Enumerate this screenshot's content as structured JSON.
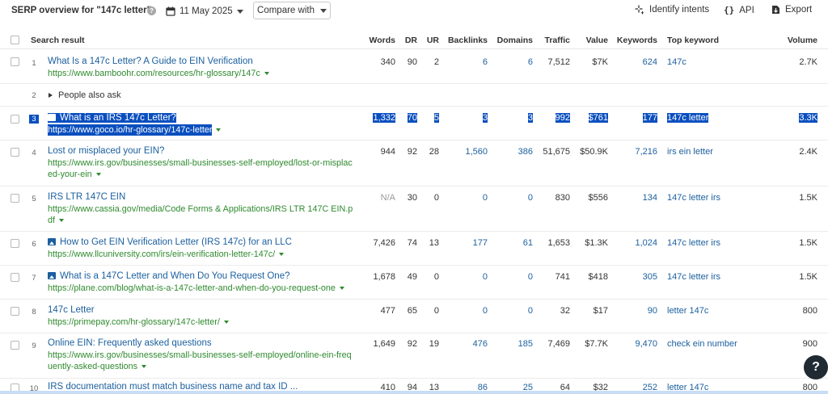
{
  "header": {
    "title": "SERP overview for \"147c letter\"",
    "date": "11 May 2025",
    "compare_label": "Compare with",
    "identify_label": "Identify intents",
    "api_label": "API",
    "export_label": "Export"
  },
  "columns": {
    "result": "Search result",
    "words": "Words",
    "dr": "DR",
    "ur": "UR",
    "backlinks": "Backlinks",
    "domains": "Domains",
    "traffic": "Traffic",
    "value": "Value",
    "keywords": "Keywords",
    "top_keyword": "Top keyword",
    "volume": "Volume"
  },
  "rows": [
    {
      "idx": "1",
      "title": "What Is a 147c Letter? A Guide to EIN Verification",
      "url_lines": [
        "https://www.bamboohr.com/resources/hr-glossary/147c"
      ],
      "words": "340",
      "dr": "90",
      "ur": "2",
      "backlinks": "6",
      "domains": "6",
      "traffic": "7,512",
      "value": "$7K",
      "keywords": "624",
      "top_keyword": "147c",
      "volume": "2.7K"
    },
    {
      "idx": "2",
      "paa": "People also ask"
    },
    {
      "idx": "3",
      "title": "What is an IRS 147c Letter?",
      "url_lines": [
        "https://www.goco.io/hr-glossary/147c-letter"
      ],
      "words": "1,332",
      "dr": "70",
      "ur": "5",
      "backlinks": "3",
      "domains": "3",
      "traffic": "992",
      "value": "$761",
      "keywords": "177",
      "top_keyword": "147c letter",
      "volume": "3.3K"
    },
    {
      "idx": "4",
      "title": "Lost or misplaced your EIN?",
      "url_lines": [
        "https://www.irs.gov/businesses/small-businesses-self-employed/lost-or-misplac",
        "ed-your-ein"
      ],
      "words": "944",
      "dr": "92",
      "ur": "28",
      "backlinks": "1,560",
      "domains": "386",
      "traffic": "51,675",
      "value": "$50.9K",
      "keywords": "7,216",
      "top_keyword": "irs ein letter",
      "volume": "2.4K"
    },
    {
      "idx": "5",
      "title": "IRS LTR 147C EIN",
      "url_lines": [
        "https://www.cassia.gov/media/Code Forms & Applications/IRS LTR 147C EIN.p",
        "df"
      ],
      "words": "N/A",
      "dr": "30",
      "ur": "0",
      "backlinks": "0",
      "domains": "0",
      "traffic": "830",
      "value": "$556",
      "keywords": "134",
      "top_keyword": "147c letter irs",
      "volume": "1.5K"
    },
    {
      "idx": "6",
      "title": "How to Get EIN Verification Letter (IRS 147c) for an LLC",
      "url_lines": [
        "https://www.llcuniversity.com/irs/ein-verification-letter-147c/"
      ],
      "words": "7,426",
      "dr": "74",
      "ur": "13",
      "backlinks": "177",
      "domains": "61",
      "traffic": "1,653",
      "value": "$1.3K",
      "keywords": "1,024",
      "top_keyword": "147c letter irs",
      "volume": "1.5K"
    },
    {
      "idx": "7",
      "title": "What is a 147C Letter and When Do You Request One?",
      "url_lines": [
        "https://plane.com/blog/what-is-a-147c-letter-and-when-do-you-request-one"
      ],
      "words": "1,678",
      "dr": "49",
      "ur": "0",
      "backlinks": "0",
      "domains": "0",
      "traffic": "741",
      "value": "$418",
      "keywords": "305",
      "top_keyword": "147c letter irs",
      "volume": "1.5K"
    },
    {
      "idx": "8",
      "title": "147c Letter",
      "url_lines": [
        "https://primepay.com/hr-glossary/147c-letter/"
      ],
      "words": "477",
      "dr": "65",
      "ur": "0",
      "backlinks": "0",
      "domains": "0",
      "traffic": "32",
      "value": "$17",
      "keywords": "90",
      "top_keyword": "letter 147c",
      "volume": "800"
    },
    {
      "idx": "9",
      "title": "Online EIN: Frequently asked questions",
      "url_lines": [
        "https://www.irs.gov/businesses/small-businesses-self-employed/online-ein-freq",
        "uently-asked-questions"
      ],
      "words": "1,649",
      "dr": "92",
      "ur": "19",
      "backlinks": "476",
      "domains": "185",
      "traffic": "7,469",
      "value": "$7.7K",
      "keywords": "9,470",
      "top_keyword": "check ein number",
      "volume": "900"
    },
    {
      "idx": "10",
      "title": "IRS documentation must match business name and tax ID ...",
      "url_lines": [],
      "words": "410",
      "dr": "94",
      "ur": "13",
      "backlinks": "86",
      "domains": "25",
      "traffic": "64",
      "value": "$32",
      "keywords": "252",
      "top_keyword": "letter 147c",
      "volume": "800"
    }
  ],
  "help_fab": "?",
  "colors": {
    "link": "#1b5f9e",
    "url": "#2f8a2f",
    "highlight": "#0a4fbf"
  }
}
